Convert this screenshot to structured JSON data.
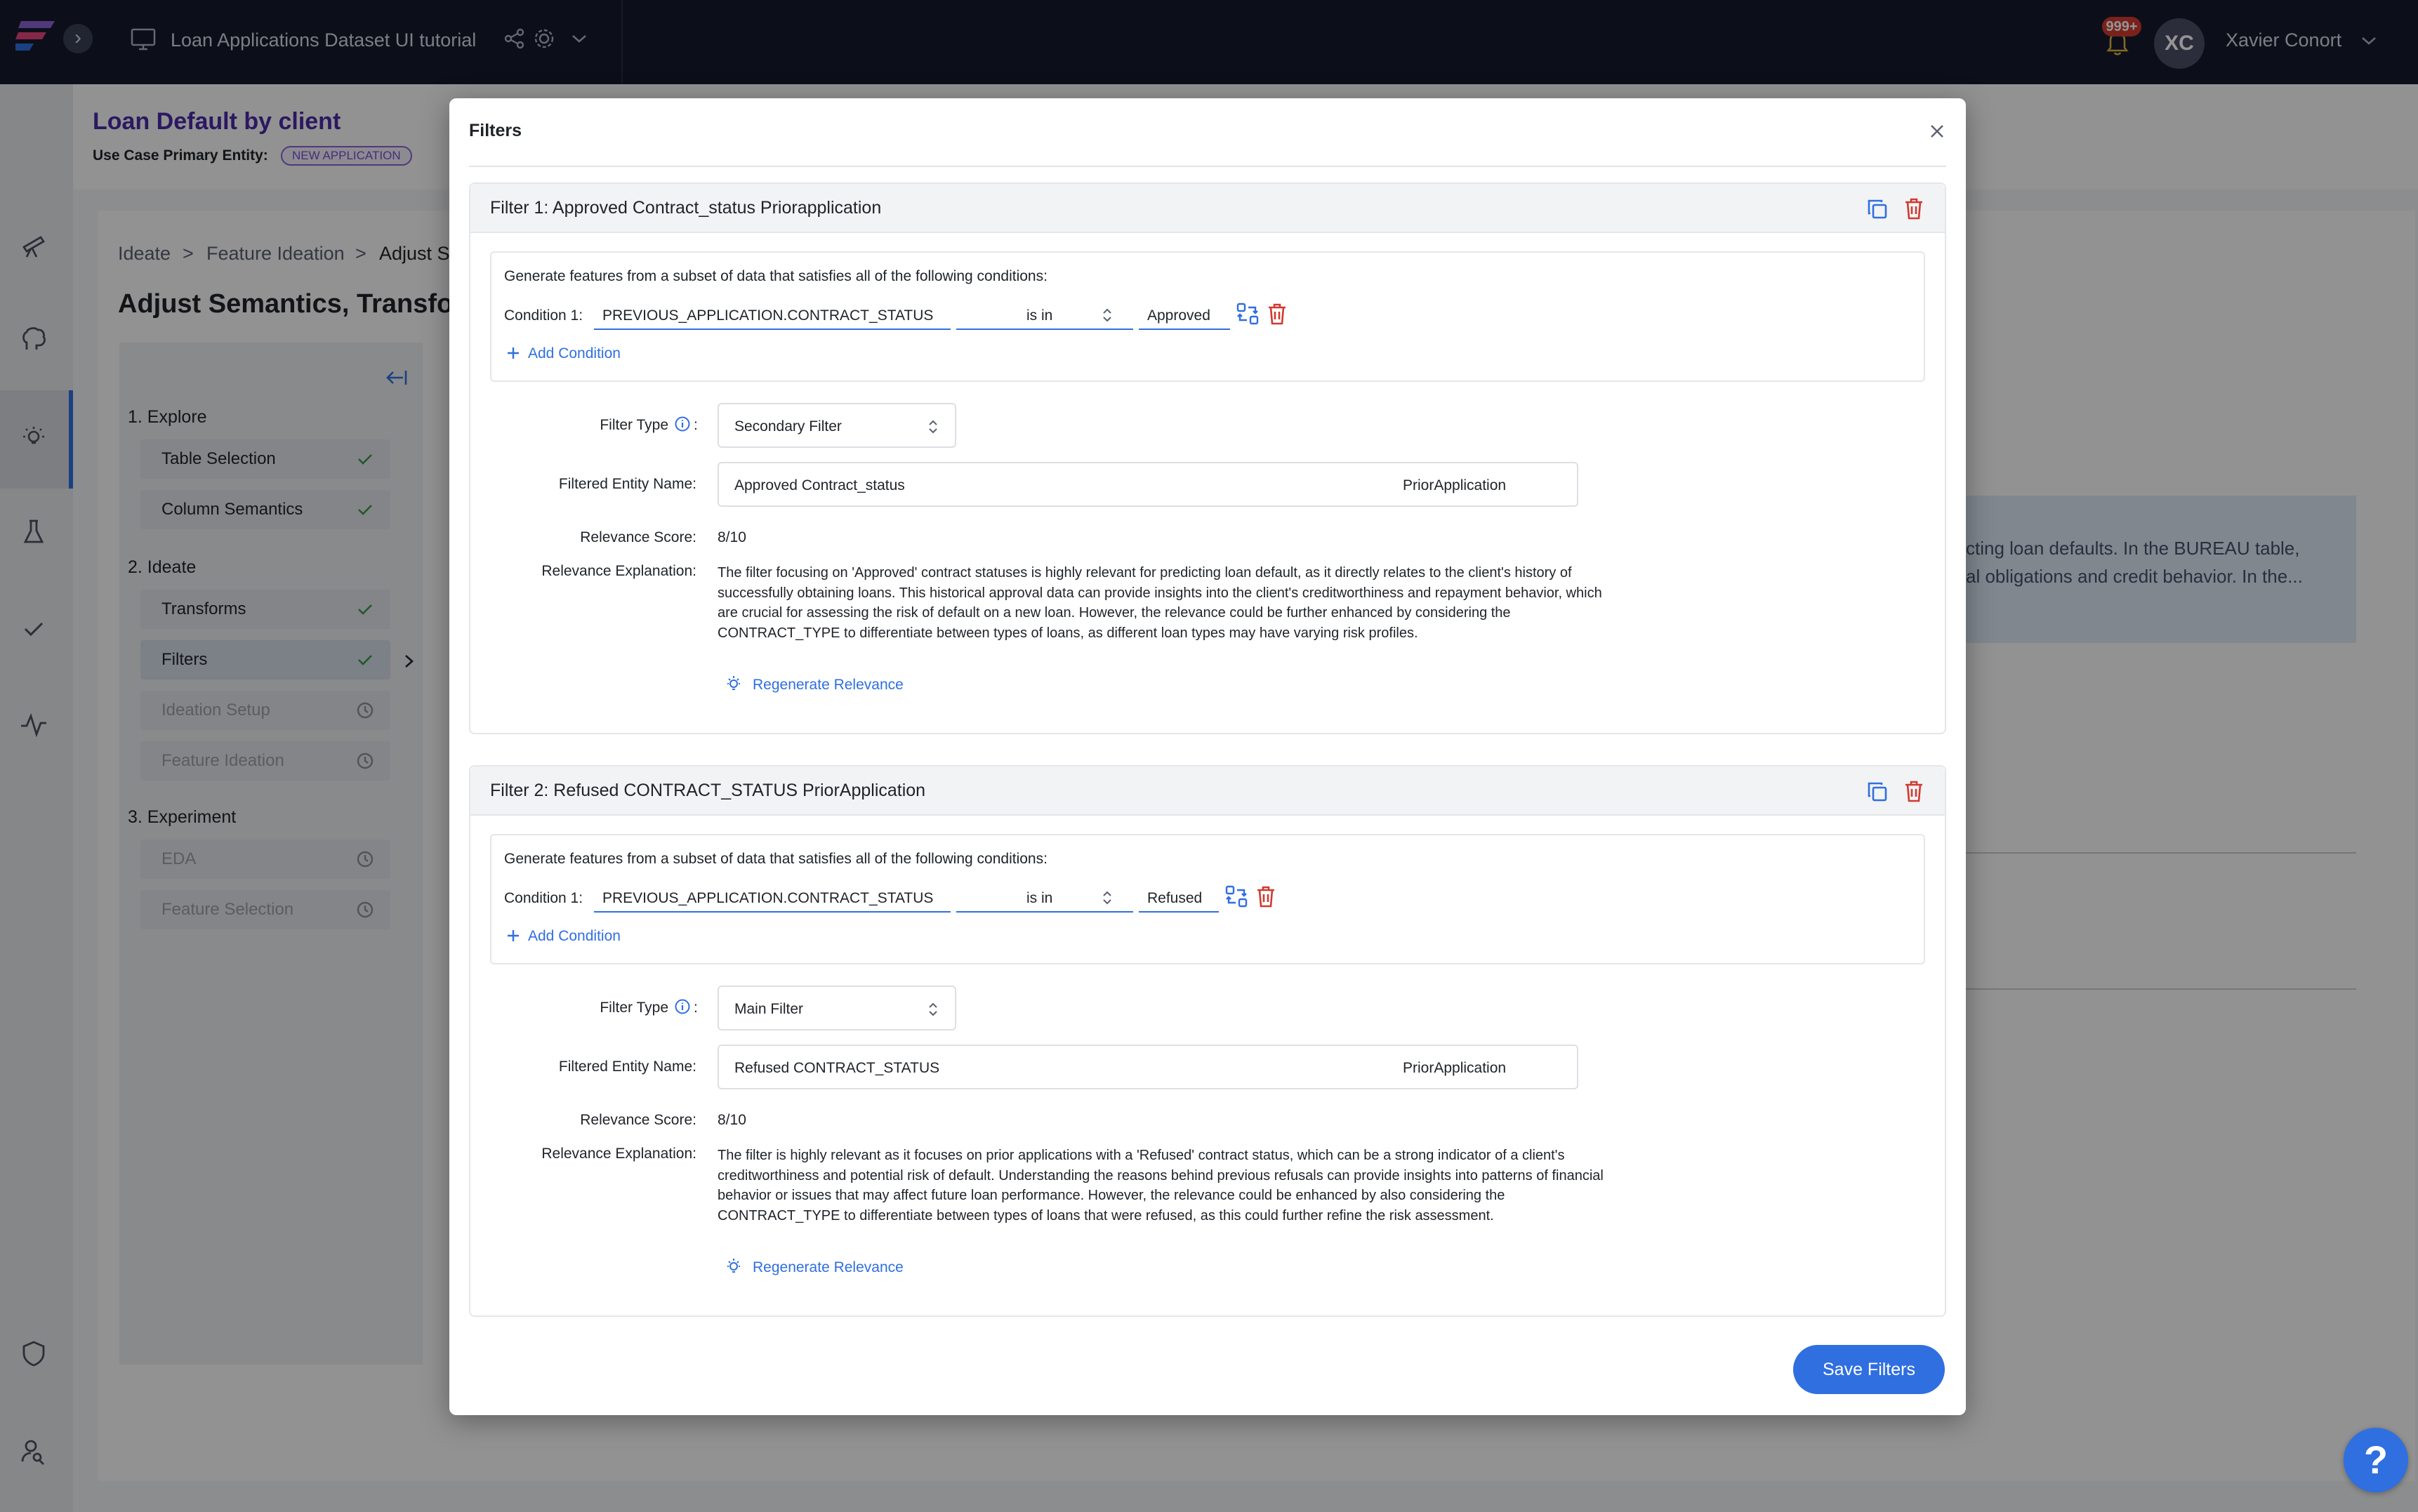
{
  "topbar": {
    "project_title": "Loan Applications Dataset UI tutorial",
    "notification_count": "999+",
    "user_initials": "XC",
    "user_name": "Xavier Conort"
  },
  "page": {
    "title": "Loan Default by client",
    "entity_label": "Use Case Primary Entity:",
    "entity_badge": "NEW APPLICATION",
    "breadcrumb": [
      "Ideate",
      ">",
      "Feature Ideation",
      ">",
      "Adjust S"
    ],
    "heading": "Adjust Semantics, Transfor",
    "steps": {
      "explore": {
        "label": "1. Explore",
        "items": [
          "Table Selection",
          "Column Semantics"
        ]
      },
      "ideate": {
        "label": "2. Ideate",
        "items": [
          "Transforms",
          "Filters",
          "Ideation Setup",
          "Feature Ideation"
        ]
      },
      "experiment": {
        "label": "3. Experiment",
        "items": [
          "EDA",
          "Feature Selection"
        ]
      }
    },
    "background_text_1": "cting loan defaults. In the BUREAU table,",
    "background_text_2": "al obligations and credit behavior. In the..."
  },
  "modal": {
    "title": "Filters",
    "save_label": "Save Filters",
    "labels": {
      "intro": "Generate features from a subset of data that satisfies all of the following conditions:",
      "condition": "Condition 1:",
      "add_condition": "Add Condition",
      "filter_type": "Filter Type",
      "filtered_entity_name": "Filtered Entity Name:",
      "relevance_score": "Relevance Score:",
      "relevance_explanation": "Relevance Explanation:",
      "regenerate": "Regenerate Relevance",
      "colon": ":"
    },
    "filters": [
      {
        "title": "Filter 1: Approved Contract_status Priorapplication",
        "condition_field": "PREVIOUS_APPLICATION.CONTRACT_STATUS",
        "condition_op": "is in",
        "condition_value": "Approved",
        "filter_type": "Secondary Filter",
        "entity_name": "Approved Contract_status",
        "entity_parent": "PriorApplication",
        "relevance_score": "8/10",
        "explanation": "The filter focusing on 'Approved' contract statuses is highly relevant for predicting loan default, as it directly relates to the client's history of successfully obtaining loans. This historical approval data can provide insights into the client's creditworthiness and repayment behavior, which are crucial for assessing the risk of default on a new loan. However, the relevance could be further enhanced by considering the CONTRACT_TYPE to differentiate between types of loans, as different loan types may have varying risk profiles."
      },
      {
        "title": "Filter 2: Refused CONTRACT_STATUS PriorApplication",
        "condition_field": "PREVIOUS_APPLICATION.CONTRACT_STATUS",
        "condition_op": "is in",
        "condition_value": "Refused",
        "filter_type": "Main Filter",
        "entity_name": "Refused CONTRACT_STATUS",
        "entity_parent": "PriorApplication",
        "relevance_score": "8/10",
        "explanation": "The filter is highly relevant as it focuses on prior applications with a 'Refused' contract status, which can be a strong indicator of a client's creditworthiness and potential risk of default. Understanding the reasons behind previous refusals can provide insights into patterns of financial behavior or issues that may affect future loan performance. However, the relevance could be enhanced by also considering the CONTRACT_TYPE to differentiate between types of loans that were refused, as this could further refine the risk assessment."
      }
    ]
  },
  "help_label": "?",
  "colors": {
    "accent": "#2f6fe0",
    "danger": "#d13a2f",
    "topbar": "#151b2d",
    "title_purple": "#4a2aa8",
    "check_green": "#3a9a4a"
  }
}
